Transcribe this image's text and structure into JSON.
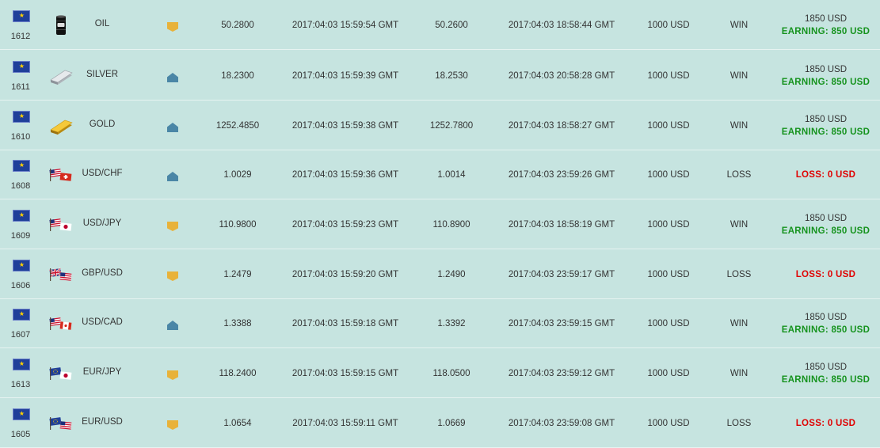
{
  "trades": [
    {
      "id": "1612",
      "asset": "OIL",
      "asset_icon": "oil-barrel-icon",
      "direction": "up",
      "open_price": "50.2800",
      "open_time": "2017:04:03 15:59:54 GMT",
      "close_price": "50.2600",
      "close_time": "2017:04:03 18:58:44 GMT",
      "amount": "1000 USD",
      "result": "WIN",
      "payout": "1850 USD",
      "earning": "EARNING: 850 USD"
    },
    {
      "id": "1611",
      "asset": "SILVER",
      "asset_icon": "silver-bar-icon",
      "direction": "down",
      "open_price": "18.2300",
      "open_time": "2017:04:03 15:59:39 GMT",
      "close_price": "18.2530",
      "close_time": "2017:04:03 20:58:28 GMT",
      "amount": "1000 USD",
      "result": "WIN",
      "payout": "1850 USD",
      "earning": "EARNING: 850 USD"
    },
    {
      "id": "1610",
      "asset": "GOLD",
      "asset_icon": "gold-bar-icon",
      "direction": "down",
      "open_price": "1252.4850",
      "open_time": "2017:04:03 15:59:38 GMT",
      "close_price": "1252.7800",
      "close_time": "2017:04:03 18:58:27 GMT",
      "amount": "1000 USD",
      "result": "WIN",
      "payout": "1850 USD",
      "earning": "EARNING: 850 USD"
    },
    {
      "id": "1608",
      "asset": "USD/CHF",
      "asset_icon": "usd-chf-flags-icon",
      "direction": "down",
      "open_price": "1.0029",
      "open_time": "2017:04:03 15:59:36 GMT",
      "close_price": "1.0014",
      "close_time": "2017:04:03 23:59:26 GMT",
      "amount": "1000 USD",
      "result": "LOSS",
      "payout": "",
      "earning": "LOSS: 0 USD"
    },
    {
      "id": "1609",
      "asset": "USD/JPY",
      "asset_icon": "usd-jpy-flags-icon",
      "direction": "up",
      "open_price": "110.9800",
      "open_time": "2017:04:03 15:59:23 GMT",
      "close_price": "110.8900",
      "close_time": "2017:04:03 18:58:19 GMT",
      "amount": "1000 USD",
      "result": "WIN",
      "payout": "1850 USD",
      "earning": "EARNING: 850 USD"
    },
    {
      "id": "1606",
      "asset": "GBP/USD",
      "asset_icon": "gbp-usd-flags-icon",
      "direction": "up",
      "open_price": "1.2479",
      "open_time": "2017:04:03 15:59:20 GMT",
      "close_price": "1.2490",
      "close_time": "2017:04:03 23:59:17 GMT",
      "amount": "1000 USD",
      "result": "LOSS",
      "payout": "",
      "earning": "LOSS: 0 USD"
    },
    {
      "id": "1607",
      "asset": "USD/CAD",
      "asset_icon": "usd-cad-flags-icon",
      "direction": "down",
      "open_price": "1.3388",
      "open_time": "2017:04:03 15:59:18 GMT",
      "close_price": "1.3392",
      "close_time": "2017:04:03 23:59:15 GMT",
      "amount": "1000 USD",
      "result": "WIN",
      "payout": "1850 USD",
      "earning": "EARNING: 850 USD"
    },
    {
      "id": "1613",
      "asset": "EUR/JPY",
      "asset_icon": "eur-jpy-flags-icon",
      "direction": "up",
      "open_price": "118.2400",
      "open_time": "2017:04:03 15:59:15 GMT",
      "close_price": "118.0500",
      "close_time": "2017:04:03 23:59:12 GMT",
      "amount": "1000 USD",
      "result": "WIN",
      "payout": "1850 USD",
      "earning": "EARNING: 850 USD"
    },
    {
      "id": "1605",
      "asset": "EUR/USD",
      "asset_icon": "eur-usd-flags-icon",
      "direction": "up",
      "open_price": "1.0654",
      "open_time": "2017:04:03 15:59:11 GMT",
      "close_price": "1.0669",
      "close_time": "2017:04:03 23:59:08 GMT",
      "amount": "1000 USD",
      "result": "LOSS",
      "payout": "",
      "earning": "LOSS: 0 USD"
    }
  ],
  "colors": {
    "background": "#c6e4e0",
    "earning": "#16931e",
    "loss": "#e00000",
    "up_marker": "#e8b23a",
    "down_marker": "#4a86a6"
  }
}
